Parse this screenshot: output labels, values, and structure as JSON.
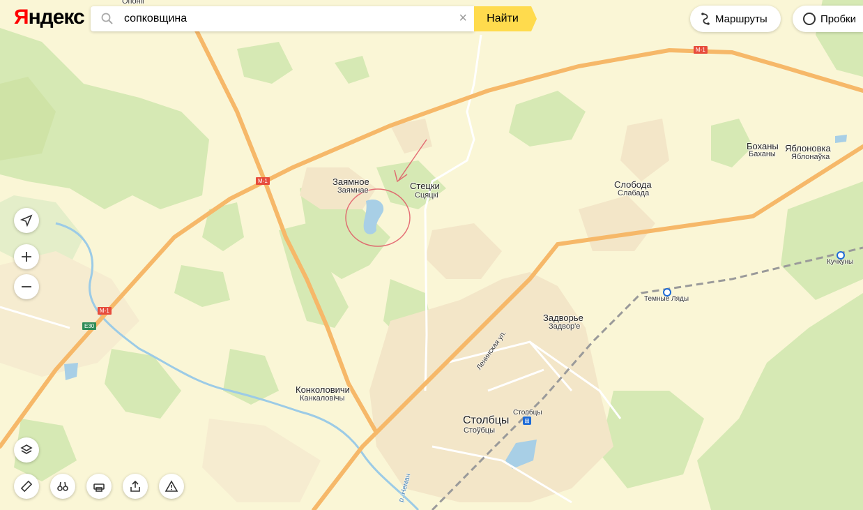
{
  "brand": {
    "logo_first": "Я",
    "logo_rest": "ндекс"
  },
  "search": {
    "value": "сопковщина",
    "clear": "×",
    "button": "Найти"
  },
  "top_buttons": {
    "routes": "Маршруты",
    "traffic": "Пробки"
  },
  "map_labels": {
    "zayamnoe": "Заямное",
    "zayamnoe_by": "Заямнае",
    "stetski": "Стецки",
    "stetski_by": "Сцяцкі",
    "sloboda": "Слобода",
    "sloboda_by": "Слабада",
    "bokhany": "Боханы",
    "bokhany_by": "Баханы",
    "yablonovka": "Яблоновка",
    "yablonovka_by": "Яблонаўка",
    "zadvorye": "Задворье",
    "zadvorye_by": "Задвор'е",
    "konkolovichi": "Конколовичи",
    "konkolovichi_by": "Канкаловічы",
    "stolbtsy": "Столбцы",
    "stolbtsy_by": "Стоўбцы",
    "stolbtsy_station": "Столбцы",
    "kuchkuny": "Кучкуны",
    "temnye_lyady": "Темные Ляды",
    "leninskaya": "Ленинская ул.",
    "neman": "р. Неман",
    "top_cut": "Опоніі"
  },
  "road_shields": {
    "m1": "M-1",
    "e30": "E30"
  },
  "colors": {
    "forest": "#d6e9b4",
    "forest_dark": "#cfe3a6",
    "settlement": "#f3e6c8",
    "background": "#faf6d6",
    "highway": "#f6b869",
    "water": "#a8cfe6",
    "annotation": "#e05060",
    "search_button": "#ffdb4d"
  },
  "icons": [
    "search-icon",
    "routes-icon",
    "traffic-icon",
    "location-icon",
    "zoom-in-icon",
    "zoom-out-icon",
    "layers-icon",
    "ruler-icon",
    "panorama-icon",
    "print-icon",
    "share-icon",
    "warning-icon",
    "railway-station-icon"
  ]
}
